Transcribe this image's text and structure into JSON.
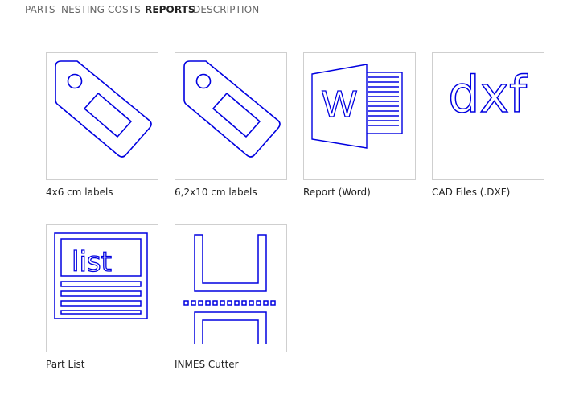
{
  "tabs": [
    {
      "label": "PARTS",
      "active": false
    },
    {
      "label": "NESTING",
      "active": false
    },
    {
      "label": "COSTS",
      "active": false
    },
    {
      "label": "REPORTS",
      "active": true
    },
    {
      "label": "DESCRIPTION",
      "active": false
    }
  ],
  "reports": [
    {
      "label": "4x6 cm labels",
      "icon": "tag-icon"
    },
    {
      "label": "6,2x10 cm labels",
      "icon": "tag-icon"
    },
    {
      "label": "Report (Word)",
      "icon": "word-document-icon"
    },
    {
      "label": "CAD Files (.DXF)",
      "icon": "dxf-icon"
    },
    {
      "label": "Part List",
      "icon": "part-list-icon",
      "icon_text": "list"
    },
    {
      "label": "INMES Cutter",
      "icon": "cutter-icon"
    }
  ],
  "icon_texts": {
    "word": "W",
    "dxf": "dxf",
    "list": "list"
  },
  "colors": {
    "icon_stroke": "#0000e0",
    "tab_active": "#222222",
    "tab_inactive": "#666666",
    "tile_border": "#cfcfcf"
  }
}
